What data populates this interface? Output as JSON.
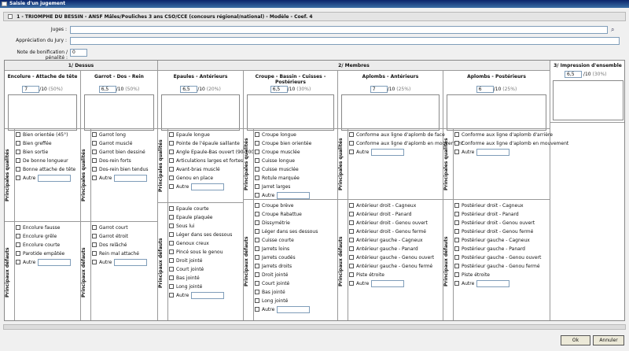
{
  "window": {
    "title": "Saisie d'un jugement"
  },
  "header": {
    "section": "1 - TRIOMPHE DU BESSIN - ANSF Mâles/Pouliches 3 ans CSO/CCE (concours régional/national) - Modèle - Coef. 4"
  },
  "form": {
    "juges_label": "Juges :",
    "appreciation_label": "Appréciation du Jury :",
    "bonif_label": "Note de bonification / pénalité :",
    "bonif_value": "0"
  },
  "groups": {
    "g1": "1/ Dessus",
    "g2": "2/ Membres",
    "g3": "3/ Impression d'ensemble"
  },
  "labels": {
    "qual": "Principales qualités",
    "def": "Principaux défauts"
  },
  "autre": "Autre",
  "impression": {
    "note": "6,5",
    "max": "/10",
    "pct": "(30%)"
  },
  "columns": [
    {
      "title": "Encolure - Attache de tête",
      "note": "7",
      "max": "/10",
      "pct": "(50%)",
      "qualites": [
        "Bien orientée (45°)",
        "Bien greffée",
        "Bien sortie",
        "De bonne longueur",
        "Bonne attache de tête"
      ],
      "defauts": [
        "Encolure fausse",
        "Encolure grêle",
        "Encolure courte",
        "Parotide empâtée"
      ]
    },
    {
      "title": "Garrot - Dos - Rein",
      "note": "6,5",
      "max": "/10",
      "pct": "(50%)",
      "qualites": [
        "Garrot long",
        "Garrot musclé",
        "Garrot bien dessiné",
        "Dos-rein forts",
        "Dos-rein bien tendus"
      ],
      "defauts": [
        "Garrot court",
        "Garrot étroit",
        "Dos relâché",
        "Rein mal attaché"
      ]
    },
    {
      "title": "Epaules - Antérieurs",
      "note": "6,5",
      "max": "/10",
      "pct": "(20%)",
      "qualites": [
        "Epaule longue",
        "Pointe de l'épaule saillante",
        "Angle Epaule-Bas ouvert (90-100°)",
        "Articulations larges et fortes",
        "Avant-bras musclé",
        "Genou en place"
      ],
      "defauts": [
        "Epaule courte",
        "Epaule plaquée",
        "Sous lui",
        "Léger dans ses dessous",
        "Genoux creux",
        "Pincé sous le genou",
        "Droit jointé",
        "Court jointé",
        "Bas jointé",
        "Long jointé"
      ]
    },
    {
      "title": "Croupe - Bassin - Cuisses - Postérieurs",
      "note": "6,5",
      "max": "/10",
      "pct": "(30%)",
      "qualites": [
        "Croupe longue",
        "Croupe bien orientée",
        "Croupe musclée",
        "Cuisse longue",
        "Cuisse musclée",
        "Rotule marquée",
        "Jarret larges"
      ],
      "defauts": [
        "Croupe brève",
        "Croupe Rabattue",
        "Dissymétrie",
        "Léger dans ses dessous",
        "Cuisse courte",
        "Jarrets loins",
        "Jarrets coudés",
        "Jarrets droits",
        "Droit jointé",
        "Court jointé",
        "Bas jointé",
        "Long jointé"
      ]
    },
    {
      "title": "Aplombs - Antérieurs",
      "note": "7",
      "max": "/10",
      "pct": "(25%)",
      "qualites": [
        "Conforme aux ligne d'aplomb de face",
        "Conforme aux ligne d'aplomb en mouvement"
      ],
      "defauts": [
        "Antérieur droit - Cagneux",
        "Antérieur droit - Panard",
        "Antérieur droit - Genou ouvert",
        "Antérieur droit - Genou fermé",
        "Antérieur gauche - Cagneux",
        "Antérieur gauche - Panard",
        "Antérieur gauche - Genou ouvert",
        "Antérieur gauche - Genou fermé",
        "Piste étroite"
      ]
    },
    {
      "title": "Aplombs - Postérieurs",
      "note": "6",
      "max": "/10",
      "pct": "(25%)",
      "qualites": [
        "Conforme aux ligne d'aplomb d'arrière",
        "Conforme aux ligne d'aplomb en mouvement"
      ],
      "defauts": [
        "Postérieur droit - Cagneux",
        "Postérieur droit - Panard",
        "Postérieur droit - Genou ouvert",
        "Postérieur droit - Genou fermé",
        "Postérieur gauche - Cagneux",
        "Postérieur gauche - Panard",
        "Postérieur gauche - Genou ouvert",
        "Postérieur gauche - Genou fermé",
        "Piste étroite"
      ]
    }
  ],
  "buttons": {
    "ok": "Ok",
    "cancel": "Annuler"
  }
}
